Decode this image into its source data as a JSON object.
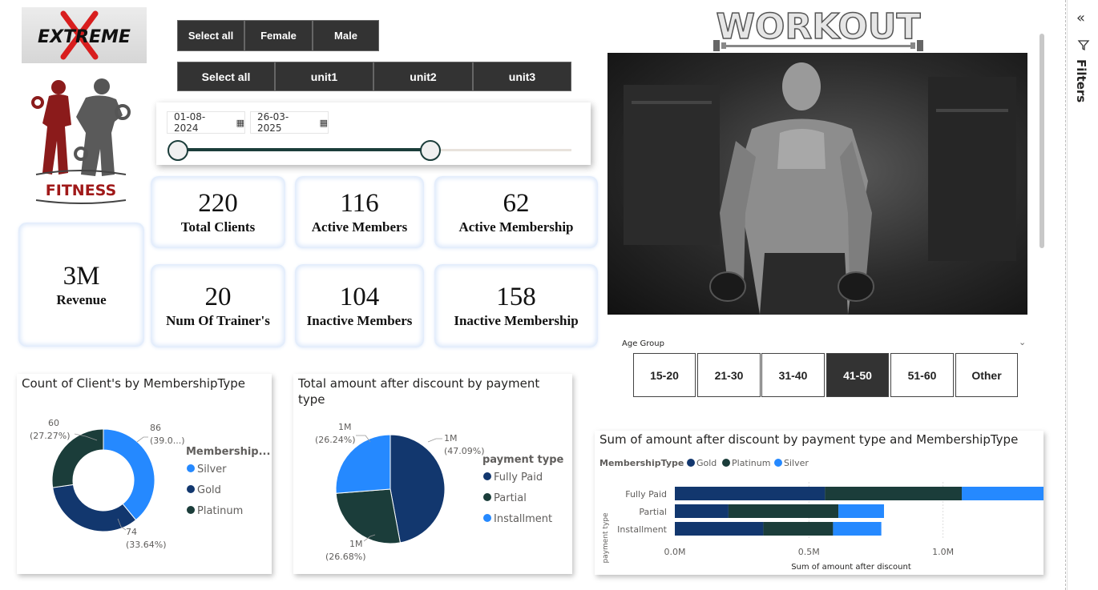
{
  "brand": {
    "logo_text": "EXTREME",
    "fitness_text": "FITNESS",
    "workout_text": "WORKOUT"
  },
  "gender_slicer": [
    "Select all",
    "Female",
    "Male"
  ],
  "unit_slicer": [
    "Select all",
    "unit1",
    "unit2",
    "unit3"
  ],
  "date_range": {
    "start": "01-08-2024",
    "end": "26-03-2025",
    "start_frac": 0.0,
    "end_frac": 0.6
  },
  "kpis": {
    "revenue": {
      "value": "3M",
      "label": "Revenue"
    },
    "total_clients": {
      "value": "220",
      "label": "Total Clients"
    },
    "active_members": {
      "value": "116",
      "label": "Active Members"
    },
    "active_membership": {
      "value": "62",
      "label": "Active Membership"
    },
    "num_trainers": {
      "value": "20",
      "label": "Num Of Trainer's"
    },
    "inactive_members": {
      "value": "104",
      "label": "Inactive Members"
    },
    "inactive_membership": {
      "value": "158",
      "label": "Inactive Membership"
    }
  },
  "age_group": {
    "title": "Age Group",
    "options": [
      "15-20",
      "21-30",
      "31-40",
      "41-50",
      "51-60",
      "Other"
    ],
    "selected": "41-50"
  },
  "colors": {
    "gold": "#12376e",
    "platinum": "#1b3d3a",
    "silver": "#2589ff",
    "slicer_dark": "#333333"
  },
  "filters_pane": {
    "label": "Filters"
  },
  "chart_data": [
    {
      "type": "donut",
      "title": "Count of Client's by MembershipType",
      "legend_title": "Membership...",
      "legend": [
        "Silver",
        "Gold",
        "Platinum"
      ],
      "slices": [
        {
          "name": "Silver",
          "value": 86,
          "label": "86",
          "pct": "(39.0...)"
        },
        {
          "name": "Gold",
          "value": 74,
          "label": "74",
          "pct": "(33.64%)"
        },
        {
          "name": "Platinum",
          "value": 60,
          "label": "60",
          "pct": "(27.27%)"
        }
      ]
    },
    {
      "type": "pie",
      "title": "Total amount after discount by payment type",
      "legend_title": "payment type",
      "legend": [
        "Fully Paid",
        "Partial",
        "Installment"
      ],
      "slices": [
        {
          "name": "Fully Paid",
          "value": 47.09,
          "label": "1M",
          "pct": "(47.09%)"
        },
        {
          "name": "Partial",
          "value": 26.68,
          "label": "1M",
          "pct": "(26.68%)"
        },
        {
          "name": "Installment",
          "value": 26.24,
          "label": "1M",
          "pct": "(26.24%)"
        }
      ]
    },
    {
      "type": "bar",
      "orientation": "horizontal-stacked",
      "title": "Sum of amount after discount by payment type and MembershipType",
      "legend_title": "MembershipType",
      "legend": [
        "Gold",
        "Platinum",
        "Silver"
      ],
      "categories": [
        "Fully Paid",
        "Partial",
        "Installment"
      ],
      "series": [
        {
          "name": "Gold",
          "values": [
            0.56,
            0.2,
            0.33
          ]
        },
        {
          "name": "Platinum",
          "values": [
            0.51,
            0.41,
            0.26
          ]
        },
        {
          "name": "Silver",
          "values": [
            0.31,
            0.17,
            0.18
          ]
        }
      ],
      "xlabel": "Sum of amount after discount",
      "ylabel": "payment type",
      "xticks": [
        "0.0M",
        "0.5M",
        "1.0M"
      ],
      "xlim": [
        0,
        1.4
      ]
    }
  ]
}
